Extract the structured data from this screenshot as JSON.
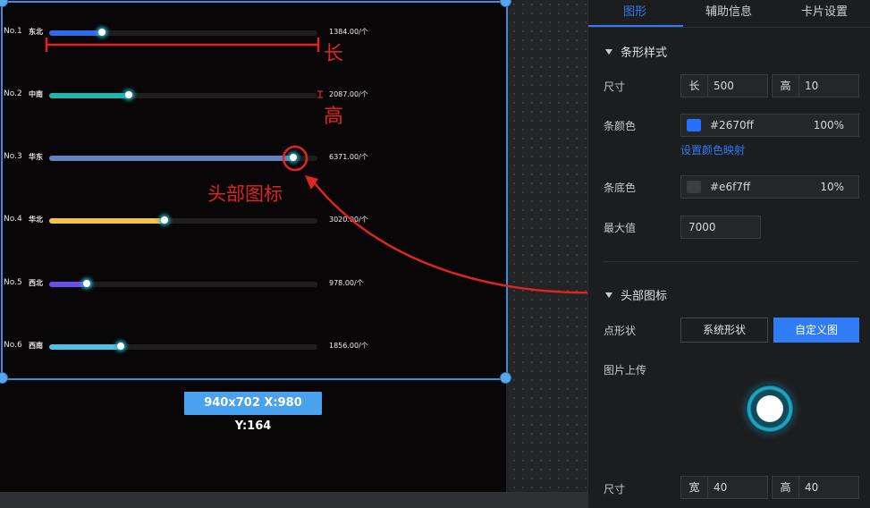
{
  "canvas": {
    "size_tag": "940x702   X:980 Y:164",
    "rows": [
      {
        "rank": "No.1",
        "region": "东北",
        "value": 1384,
        "value_label": "1384.00/个",
        "color": "#2f6be8"
      },
      {
        "rank": "No.2",
        "region": "中南",
        "value": 2087,
        "value_label": "2087.00/个",
        "color": "#1fb6a8"
      },
      {
        "rank": "No.3",
        "region": "华东",
        "value": 6371,
        "value_label": "6371.00/个",
        "color": "#6282c0"
      },
      {
        "rank": "No.4",
        "region": "华北",
        "value": 3020,
        "value_label": "3020.00/个",
        "color": "#f2c14e"
      },
      {
        "rank": "No.5",
        "region": "西北",
        "value": 978,
        "value_label": "978.00/个",
        "color": "#6a4df0"
      },
      {
        "rank": "No.6",
        "region": "西南",
        "value": 1856,
        "value_label": "1856.00/个",
        "color": "#4ec3e8"
      }
    ],
    "max": 7000,
    "annotations": {
      "length": "长",
      "height": "高",
      "head_icon": "头部图标",
      "color": "#e02424"
    }
  },
  "panel": {
    "tabs": [
      "图形",
      "辅助信息",
      "卡片设置"
    ],
    "active_tab": "图形",
    "bar_style": {
      "title": "条形样式",
      "size_label": "尺寸",
      "length_prefix": "长",
      "length_value": "500",
      "height_prefix": "高",
      "height_value": "10",
      "bar_color_label": "条颜色",
      "bar_color_hex": "#2670ff",
      "bar_color_opacity": "100%",
      "bar_color_swatch": "#2670ff",
      "color_mapping_link": "设置颜色映射",
      "base_color_label": "条底色",
      "base_color_hex": "#e6f7ff",
      "base_color_opacity": "10%",
      "base_color_swatch": "#3c3d40",
      "max_label": "最大值",
      "max_value": "7000"
    },
    "head_icon": {
      "title": "头部图标",
      "shape_label": "点形状",
      "system_shape_btn": "系统形状",
      "custom_image_btn": "自定义图",
      "upload_label": "图片上传",
      "upload_icon": "glow-dot-icon",
      "size_label": "尺寸",
      "width_prefix": "宽",
      "width_value": "40",
      "height_prefix": "高",
      "height_value": "40"
    }
  }
}
